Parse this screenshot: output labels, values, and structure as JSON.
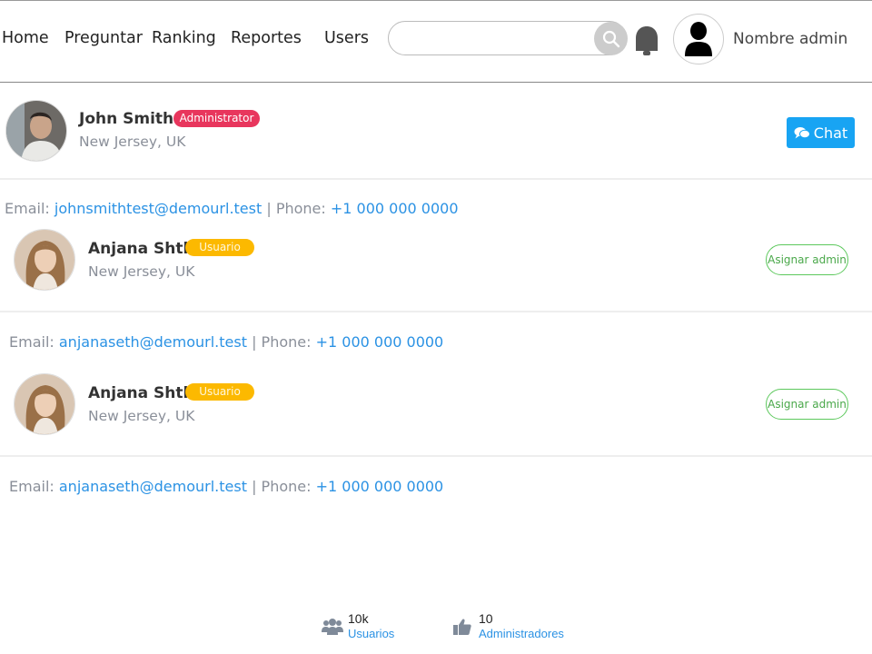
{
  "nav": {
    "items": [
      "Home",
      "Preguntar",
      "Ranking",
      "Reportes",
      "Users"
    ],
    "search_placeholder": "",
    "admin_name": "Nombre admin"
  },
  "profile": {
    "name": "John Smith",
    "role": "Administrator",
    "location": "New Jersey, UK",
    "chat_label": "Chat",
    "email_label": "Email:",
    "email": "johnsmithtest@demourl.test",
    "phone_label": "Phone:",
    "phone": "+1 000 000 0000"
  },
  "users": [
    {
      "name": "Anjana Shth",
      "role": "Usuario",
      "location": "New Jersey, UK",
      "action": "Asignar admin",
      "email_label": "Email:",
      "email": "anjanaseth@demourl.test",
      "phone_label": "Phone:",
      "phone": "+1 000 000 0000"
    },
    {
      "name": "Anjana Shth",
      "role": "Usuario",
      "location": "New Jersey, UK",
      "action": "Asignar admin",
      "email_label": "Email:",
      "email": "anjanaseth@demourl.test",
      "phone_label": "Phone:",
      "phone": "+1 000 000 0000"
    }
  ],
  "stats": [
    {
      "value": "10k",
      "label": "Usuarios",
      "icon": "users-icon"
    },
    {
      "value": "10",
      "label": "Administradores",
      "icon": "thumbs-up-icon"
    }
  ],
  "colors": {
    "admin_badge": "#e8365d",
    "user_badge": "#fcb900",
    "chat_button": "#18a4f3",
    "link": "#2b92e4",
    "assign_border": "#5cc85c"
  }
}
